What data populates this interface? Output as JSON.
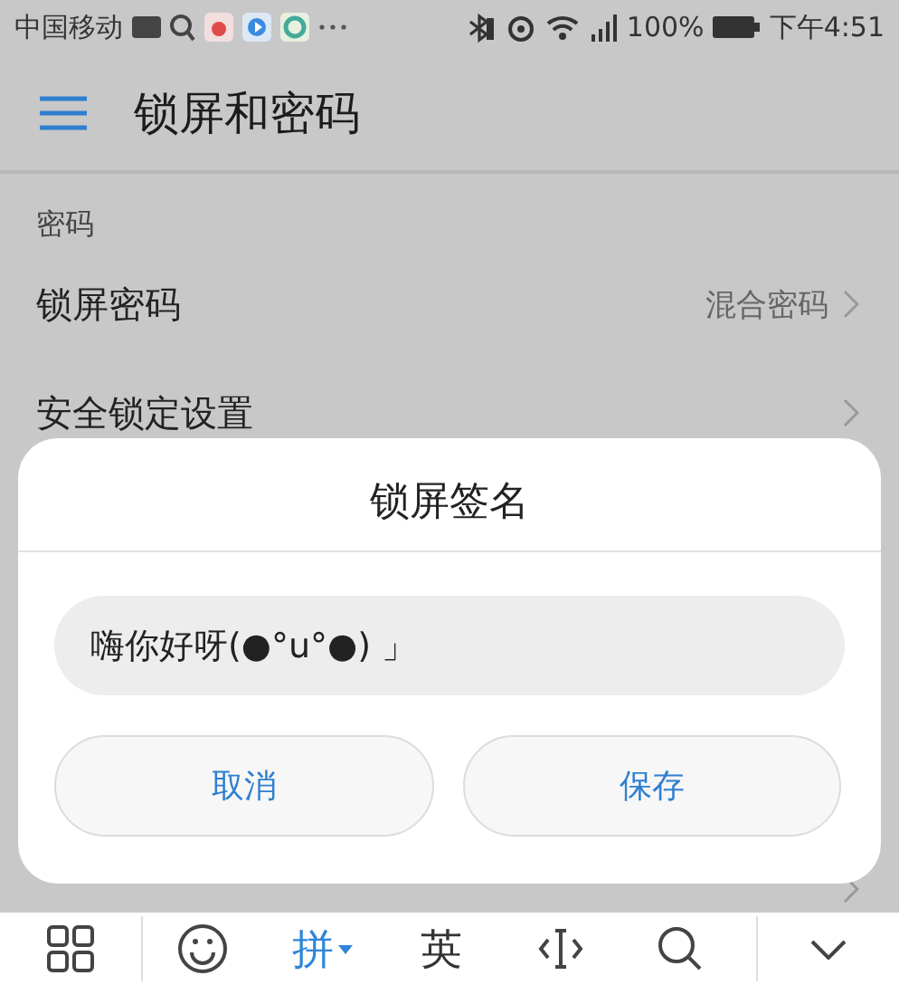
{
  "status_bar": {
    "carrier": "中国移动",
    "battery": "100%",
    "time": "下午4:51"
  },
  "app_bar": {
    "title": "锁屏和密码"
  },
  "section": {
    "title": "密码"
  },
  "rows": [
    {
      "label": "锁屏密码",
      "value": "混合密码"
    },
    {
      "label": "安全锁定设置"
    }
  ],
  "dialog": {
    "title": "锁屏签名",
    "value": "嗨你好呀(●°u°●) 」",
    "buttons": [
      "取消",
      "保存"
    ]
  },
  "keyboard": {
    "modes": [
      {
        "label": "拼",
        "selected": true
      },
      {
        "label": "英",
        "selected": false
      }
    ]
  }
}
